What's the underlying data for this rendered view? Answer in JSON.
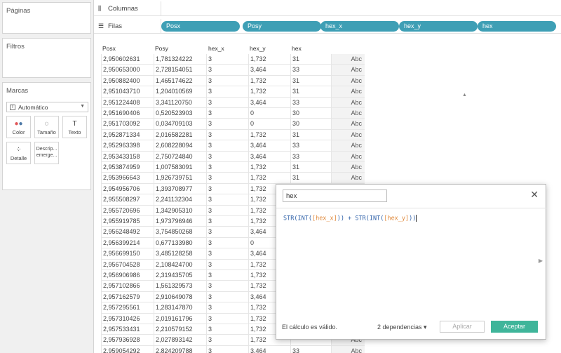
{
  "panels": {
    "pages_title": "Páginas",
    "filters_title": "Filtros",
    "marks_title": "Marcas",
    "marks_type": "Automático",
    "mark_buttons": [
      {
        "label": "Color",
        "icon": "color-dots-icon"
      },
      {
        "label": "Tamaño",
        "icon": "size-icon"
      },
      {
        "label": "Texto",
        "icon": "text-icon"
      },
      {
        "label": "Detalle",
        "icon": "detail-dots-icon"
      },
      {
        "label": "Descrip... emerge...",
        "icon": "tooltip-icon"
      }
    ]
  },
  "shelves": {
    "columns_label": "Columnas",
    "rows_label": "Filas",
    "row_pills": [
      "Posx",
      "Posy",
      "hex_x",
      "hex_y",
      "hex"
    ]
  },
  "table": {
    "headers": [
      "Posx",
      "Posy",
      "hex_x",
      "hex_y",
      "hex"
    ],
    "abc_label": "Abc",
    "rows": [
      [
        "2,950602631",
        "1,781324222",
        "3",
        "1,732",
        "31"
      ],
      [
        "2,950653000",
        "2,728154051",
        "3",
        "3,464",
        "33"
      ],
      [
        "2,950882400",
        "1,465174622",
        "3",
        "1,732",
        "31"
      ],
      [
        "2,951043710",
        "1,204010569",
        "3",
        "1,732",
        "31"
      ],
      [
        "2,951224408",
        "3,341120750",
        "3",
        "3,464",
        "33"
      ],
      [
        "2,951690406",
        "0,520523903",
        "3",
        "0",
        "30"
      ],
      [
        "2,951703092",
        "0,034709103",
        "3",
        "0",
        "30"
      ],
      [
        "2,952871334",
        "2,016582281",
        "3",
        "1,732",
        "31"
      ],
      [
        "2,952963398",
        "2,608228094",
        "3",
        "3,464",
        "33"
      ],
      [
        "2,953433158",
        "2,750724840",
        "3",
        "3,464",
        "33"
      ],
      [
        "2,953874959",
        "1,007583091",
        "3",
        "1,732",
        "31"
      ],
      [
        "2,953966643",
        "1,926739751",
        "3",
        "1,732",
        "31"
      ],
      [
        "2,954956706",
        "1,393708977",
        "3",
        "1,732",
        ""
      ],
      [
        "2,955508297",
        "2,241132304",
        "3",
        "1,732",
        ""
      ],
      [
        "2,955720696",
        "1,342905310",
        "3",
        "1,732",
        ""
      ],
      [
        "2,955919785",
        "1,973796946",
        "3",
        "1,732",
        ""
      ],
      [
        "2,956248492",
        "3,754850268",
        "3",
        "3,464",
        ""
      ],
      [
        "2,956399214",
        "0,677133980",
        "3",
        "0",
        ""
      ],
      [
        "2,956699150",
        "3,485128258",
        "3",
        "3,464",
        ""
      ],
      [
        "2,956704528",
        "2,108424700",
        "3",
        "1,732",
        ""
      ],
      [
        "2,956906986",
        "2,319435705",
        "3",
        "1,732",
        ""
      ],
      [
        "2,957102866",
        "1,561329573",
        "3",
        "1,732",
        ""
      ],
      [
        "2,957162579",
        "2,910649078",
        "3",
        "3,464",
        ""
      ],
      [
        "2,957295561",
        "1,283147870",
        "3",
        "1,732",
        ""
      ],
      [
        "2,957310426",
        "2,019161796",
        "3",
        "1,732",
        ""
      ],
      [
        "2,957533431",
        "2,210579152",
        "3",
        "1,732",
        ""
      ],
      [
        "2,957936928",
        "2,027893142",
        "3",
        "1,732",
        ""
      ],
      [
        "2,959054292",
        "2,824209788",
        "3",
        "3,464",
        "33"
      ]
    ]
  },
  "dialog": {
    "name_value": "hex",
    "formula": {
      "fn1": "STR(INT(",
      "f1": "[hex_x]",
      "mid": ")) + ",
      "fn2": "STR(INT(",
      "f2": "[hex_y]",
      "end": "))"
    },
    "valid_text": "El cálculo es válido.",
    "deps_text": "2 dependencias ▾",
    "apply_label": "Aplicar",
    "accept_label": "Aceptar"
  }
}
